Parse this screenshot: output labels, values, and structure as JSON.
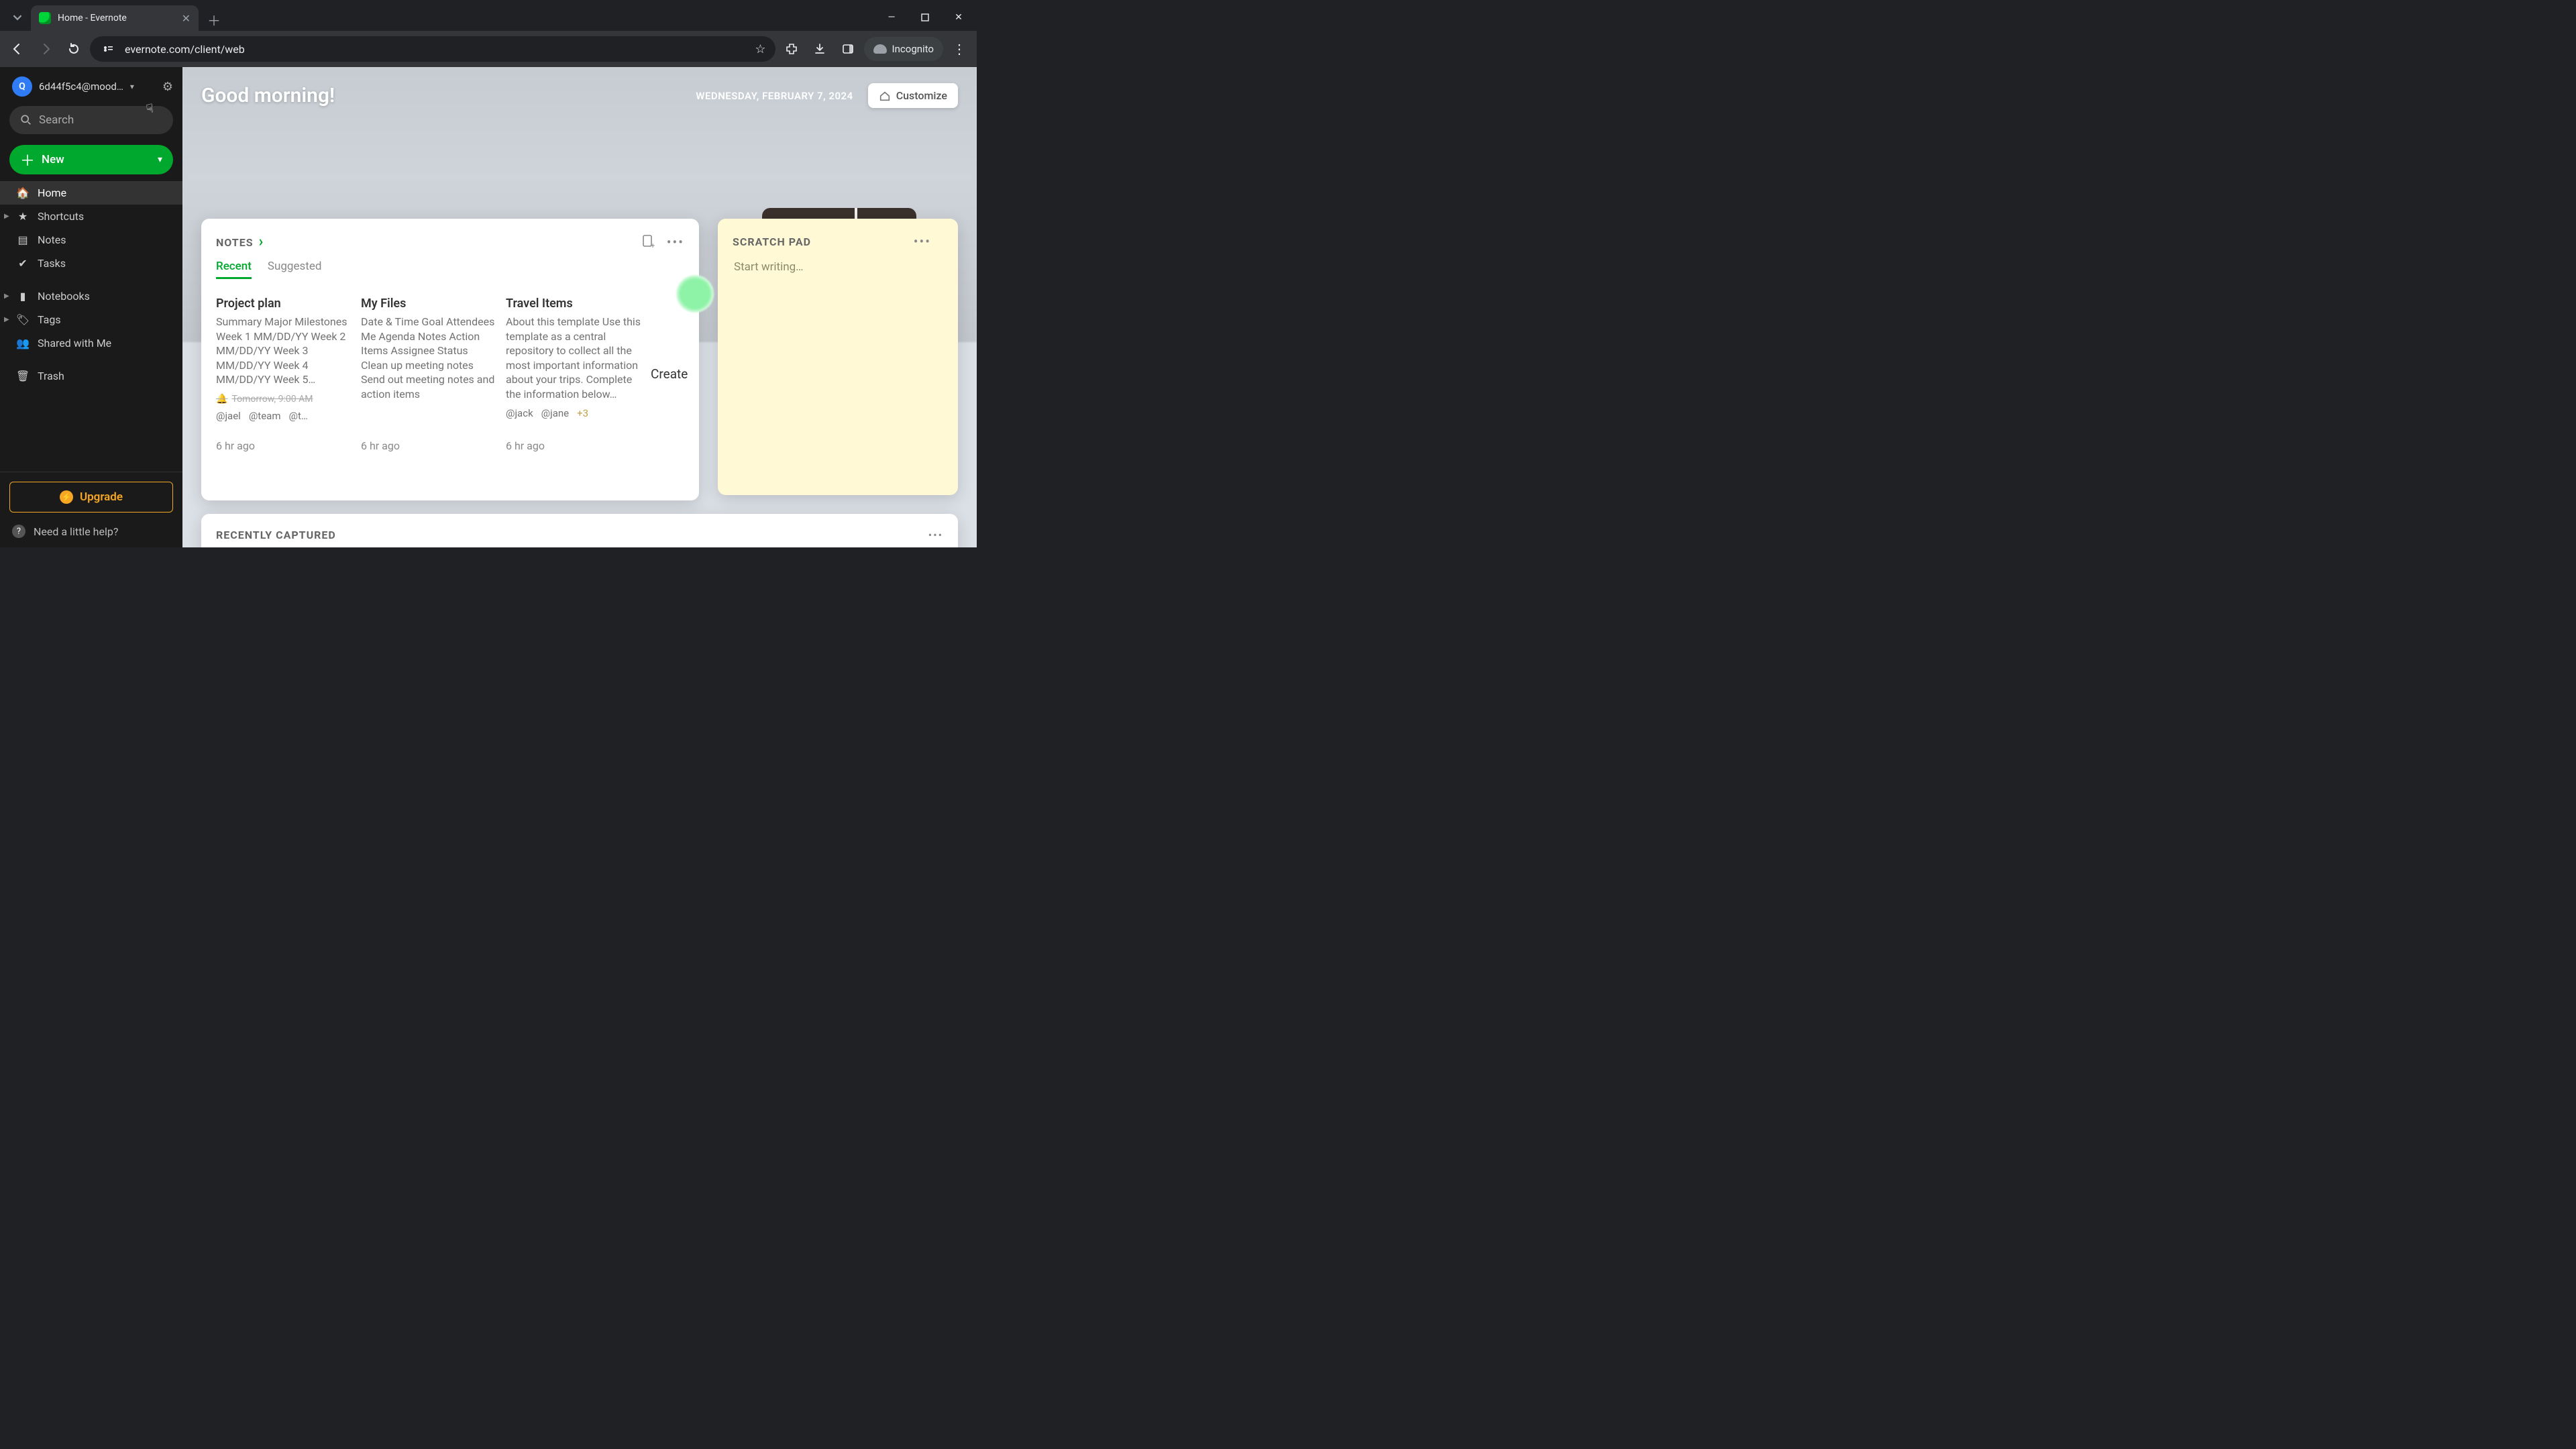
{
  "browser": {
    "tab_title": "Home - Evernote",
    "url": "evernote.com/client/web",
    "incognito_label": "Incognito"
  },
  "sidebar": {
    "avatar_initial": "Q",
    "account_name": "6d44f5c4@mood…",
    "search_placeholder": "Search",
    "new_label": "New",
    "items": [
      {
        "key": "home",
        "label": "Home",
        "icon": "🏠",
        "active": true
      },
      {
        "key": "shortcuts",
        "label": "Shortcuts",
        "icon": "★",
        "caret": true
      },
      {
        "key": "notes",
        "label": "Notes",
        "icon": "▤"
      },
      {
        "key": "tasks",
        "label": "Tasks",
        "icon": "✔"
      },
      {
        "key": "notebooks",
        "label": "Notebooks",
        "icon": "▮",
        "caret": true
      },
      {
        "key": "tags",
        "label": "Tags",
        "icon": "🏷",
        "caret": true
      },
      {
        "key": "shared",
        "label": "Shared with Me",
        "icon": "👥"
      },
      {
        "key": "trash",
        "label": "Trash",
        "icon": "🗑"
      }
    ],
    "upgrade_label": "Upgrade",
    "help_label": "Need a little help?"
  },
  "header": {
    "greeting": "Good morning!",
    "date": "WEDNESDAY, FEBRUARY 7, 2024",
    "customize_label": "Customize"
  },
  "notes_widget": {
    "title": "NOTES",
    "tabs": {
      "recent": "Recent",
      "suggested": "Suggested"
    },
    "create_label": "Create",
    "cards": [
      {
        "title": "Project plan",
        "body": "Summary Major Milestones Week 1 MM/DD/YY Week 2 MM/DD/YY Week 3 MM/DD/YY Week 4 MM/DD/YY Week 5…",
        "reminder": "Tomorrow, 9:00 AM",
        "mentions": [
          "@jael",
          "@team",
          "@t…"
        ],
        "time": "6 hr ago"
      },
      {
        "title": "My Files",
        "body": "Date & Time Goal Attendees Me Agenda Notes Action Items Assignee Status Clean up meeting notes Send out meeting notes and action items",
        "time": "6 hr ago"
      },
      {
        "title": "Travel Items",
        "body": "About this template Use this template as a central repository to collect all the most important information about your trips. Complete the information below…",
        "mentions": [
          "@jack",
          "@jane"
        ],
        "mentions_extra": "+3",
        "time": "6 hr ago"
      }
    ]
  },
  "scratch_widget": {
    "title": "SCRATCH PAD",
    "placeholder": "Start writing…"
  },
  "recent_widget": {
    "title": "RECENTLY CAPTURED"
  }
}
